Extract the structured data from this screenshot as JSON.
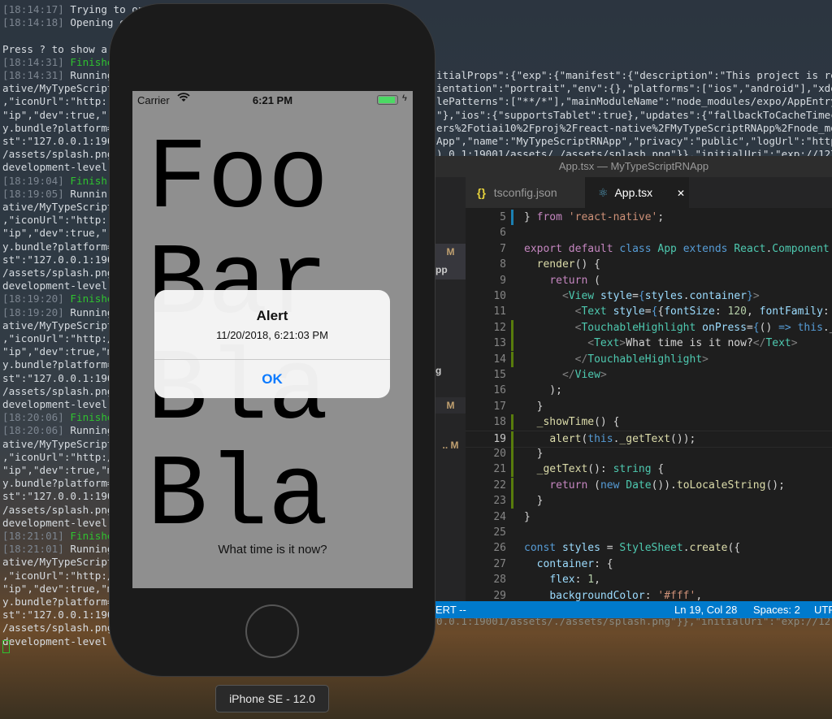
{
  "terminal": {
    "lines": [
      {
        "ts": "[18:14:17]",
        "g": "",
        "s": " Trying to open the project in iOS simulator"
      },
      {
        "ts": "[18:14:18]",
        "g": "",
        "s": " Opening e"
      },
      {
        "ts": "",
        "g": "",
        "s": ""
      },
      {
        "ts": "",
        "g": "",
        "s": "Press ? to show a"
      },
      {
        "ts": "[18:14:31]",
        "g": " Finishe",
        "s": ""
      },
      {
        "ts": "[18:14:31]",
        "g": "",
        "s": " Running"
      },
      {
        "ts": "",
        "g": "",
        "s": "ative/MyTypeScript"
      },
      {
        "ts": "",
        "g": "",
        "s": ",\"iconUrl\":\"http:"
      },
      {
        "ts": "",
        "g": "",
        "s": "\"ip\",\"dev\":true,\""
      },
      {
        "ts": "",
        "g": "",
        "s": "y.bundle?platform="
      },
      {
        "ts": "",
        "g": "",
        "s": "st\":\"127.0.0.1:190"
      },
      {
        "ts": "",
        "g": "",
        "s": "/assets/splash.png"
      },
      {
        "ts": "",
        "g": "",
        "s": "development-level"
      },
      {
        "ts": "[18:19:04]",
        "g": " Finish",
        "s": ""
      },
      {
        "ts": "[18:19:05]",
        "g": "",
        "s": " Runnin"
      },
      {
        "ts": "",
        "g": "",
        "s": "ative/MyTypeScript"
      },
      {
        "ts": "",
        "g": "",
        "s": ",\"iconUrl\":\"http:"
      },
      {
        "ts": "",
        "g": "",
        "s": "\"ip\",\"dev\":true,\""
      },
      {
        "ts": "",
        "g": "",
        "s": "y.bundle?platform="
      },
      {
        "ts": "",
        "g": "",
        "s": "st\":\"127.0.0.1:190"
      },
      {
        "ts": "",
        "g": "",
        "s": "/assets/splash.png"
      },
      {
        "ts": "",
        "g": "",
        "s": "development-level"
      },
      {
        "ts": "[18:19:20]",
        "g": " Finishe",
        "s": ""
      },
      {
        "ts": "[18:19:20]",
        "g": "",
        "s": " Running"
      },
      {
        "ts": "",
        "g": "",
        "s": "ative/MyTypeScript"
      },
      {
        "ts": "",
        "g": "",
        "s": ",\"iconUrl\":\"http:/"
      },
      {
        "ts": "",
        "g": "",
        "s": "\"ip\",\"dev\":true,\"m"
      },
      {
        "ts": "",
        "g": "",
        "s": "y.bundle?platform="
      },
      {
        "ts": "",
        "g": "",
        "s": "st\":\"127.0.0.1:190"
      },
      {
        "ts": "",
        "g": "",
        "s": "/assets/splash.png"
      },
      {
        "ts": "",
        "g": "",
        "s": "development-level"
      },
      {
        "ts": "[18:20:06]",
        "g": " Finishe",
        "s": ""
      },
      {
        "ts": "[18:20:06]",
        "g": "",
        "s": " Running"
      },
      {
        "ts": "",
        "g": "",
        "s": "ative/MyTypeScript"
      },
      {
        "ts": "",
        "g": "",
        "s": ",\"iconUrl\":\"http:/"
      },
      {
        "ts": "",
        "g": "",
        "s": "\"ip\",\"dev\":true,\"m"
      },
      {
        "ts": "",
        "g": "",
        "s": "y.bundle?platform="
      },
      {
        "ts": "",
        "g": "",
        "s": "st\":\"127.0.0.1:190"
      },
      {
        "ts": "",
        "g": "",
        "s": "/assets/splash.png"
      },
      {
        "ts": "",
        "g": "",
        "s": "development-level"
      },
      {
        "ts": "[18:21:01]",
        "g": " Finishe",
        "s": ""
      },
      {
        "ts": "[18:21:01]",
        "g": "",
        "s": " Running"
      },
      {
        "ts": "",
        "g": "",
        "s": "ative/MyTypeScript"
      },
      {
        "ts": "",
        "g": "",
        "s": ",\"iconUrl\":\"http:/"
      },
      {
        "ts": "",
        "g": "",
        "s": "\"ip\",\"dev\":true,\"m"
      },
      {
        "ts": "",
        "g": "",
        "s": "y.bundle?platform="
      },
      {
        "ts": "",
        "g": "",
        "s": "st\":\"127.0.0.1:190"
      },
      {
        "ts": "",
        "g": "",
        "s": "/assets/splash.png"
      },
      {
        "ts": "",
        "g": "",
        "s": "development-level"
      }
    ],
    "right_fragments": [
      "itialProps\":{\"exp\":{\"manifest\":{\"description\":\"This project is re",
      "ientation\":\"portrait\",\"env\":{},\"platforms\":[\"ios\",\"android\"],\"xde",
      "lePatterns\":[\"**/*\"],\"mainModuleName\":\"node_modules/expo/AppEntry",
      "\"},\"ios\":{\"supportsTablet\":true},\"updates\":{\"fallbackToCacheTimec",
      "ers%2Fotiai10%2Fproj%2Freact-native%2FMyTypeScriptRNApp%2Fnode_mo",
      "App\",\"name\":\"MyTypeScriptRNApp\",\"privacy\":\"public\",\"logUrl\":\"http",
      ").0.1:19001/assets/./assets/splash.png\"}},\"initialUri\":\"exp://127"
    ],
    "bottom_fragment": "0.0.1:19001/assets/./assets/splash.png\"}},\"initialUri\":\"exp://127"
  },
  "vscode": {
    "title": "App.tsx — MyTypeScriptRNApp",
    "sidebar_badges": [
      "M",
      "pp",
      "g",
      "M",
      ".. M"
    ],
    "tabs": [
      {
        "icon": "{}",
        "label": "tsconfig.json",
        "active": false
      },
      {
        "icon": "react-icon",
        "label": "App.tsx",
        "active": true,
        "close": "✕"
      }
    ],
    "current_line": 19,
    "lines": [
      {
        "n": 5,
        "tokens": [
          [
            "d",
            "} "
          ],
          [
            "k",
            "from"
          ],
          [
            "d",
            " "
          ],
          [
            "s",
            "'react-native'"
          ],
          [
            "d",
            ";"
          ]
        ]
      },
      {
        "n": 6,
        "tokens": []
      },
      {
        "n": 7,
        "tokens": [
          [
            "k",
            "export"
          ],
          [
            "d",
            " "
          ],
          [
            "k",
            "default"
          ],
          [
            "d",
            " "
          ],
          [
            "b",
            "class"
          ],
          [
            "d",
            " "
          ],
          [
            "t",
            "App"
          ],
          [
            "d",
            " "
          ],
          [
            "b",
            "extends"
          ],
          [
            "d",
            " "
          ],
          [
            "t",
            "React"
          ],
          [
            "d",
            "."
          ],
          [
            "t",
            "Component"
          ]
        ]
      },
      {
        "n": 8,
        "tokens": [
          [
            "d",
            "  "
          ],
          [
            "f",
            "render"
          ],
          [
            "d",
            "() {"
          ]
        ]
      },
      {
        "n": 9,
        "tokens": [
          [
            "d",
            "    "
          ],
          [
            "k",
            "return"
          ],
          [
            "d",
            " ("
          ]
        ]
      },
      {
        "n": 10,
        "tokens": [
          [
            "d",
            "      "
          ],
          [
            "g",
            "<"
          ],
          [
            "t",
            "View"
          ],
          [
            "d",
            " "
          ],
          [
            "v",
            "style"
          ],
          [
            "d",
            "="
          ],
          [
            "b",
            "{"
          ],
          [
            "v",
            "styles"
          ],
          [
            "d",
            "."
          ],
          [
            "v",
            "container"
          ],
          [
            "b",
            "}"
          ],
          [
            "g",
            ">"
          ]
        ]
      },
      {
        "n": 11,
        "tokens": [
          [
            "d",
            "        "
          ],
          [
            "g",
            "<"
          ],
          [
            "t",
            "Text"
          ],
          [
            "d",
            " "
          ],
          [
            "v",
            "style"
          ],
          [
            "d",
            "="
          ],
          [
            "b",
            "{"
          ],
          [
            "d",
            "{"
          ],
          [
            "v",
            "fontSize"
          ],
          [
            "d",
            ": "
          ],
          [
            "n",
            "120"
          ],
          [
            "d",
            ", "
          ],
          [
            "v",
            "fontFamily"
          ],
          [
            "d",
            ":"
          ]
        ]
      },
      {
        "n": 12,
        "tokens": [
          [
            "d",
            "        "
          ],
          [
            "g",
            "<"
          ],
          [
            "t",
            "TouchableHighlight"
          ],
          [
            "d",
            " "
          ],
          [
            "v",
            "onPress"
          ],
          [
            "d",
            "="
          ],
          [
            "b",
            "{"
          ],
          [
            "d",
            "() "
          ],
          [
            "b",
            "=>"
          ],
          [
            "d",
            " "
          ],
          [
            "b",
            "this"
          ],
          [
            "d",
            "._"
          ]
        ]
      },
      {
        "n": 13,
        "tokens": [
          [
            "d",
            "          "
          ],
          [
            "g",
            "<"
          ],
          [
            "t",
            "Text"
          ],
          [
            "g",
            ">"
          ],
          [
            "d",
            "What time is it now?"
          ],
          [
            "g",
            "</"
          ],
          [
            "t",
            "Text"
          ],
          [
            "g",
            ">"
          ]
        ]
      },
      {
        "n": 14,
        "tokens": [
          [
            "d",
            "        "
          ],
          [
            "g",
            "</"
          ],
          [
            "t",
            "TouchableHighlight"
          ],
          [
            "g",
            ">"
          ]
        ]
      },
      {
        "n": 15,
        "tokens": [
          [
            "d",
            "      "
          ],
          [
            "g",
            "</"
          ],
          [
            "t",
            "View"
          ],
          [
            "g",
            ">"
          ]
        ]
      },
      {
        "n": 16,
        "tokens": [
          [
            "d",
            "    );"
          ]
        ]
      },
      {
        "n": 17,
        "tokens": [
          [
            "d",
            "  }"
          ]
        ]
      },
      {
        "n": 18,
        "tokens": [
          [
            "d",
            "  "
          ],
          [
            "f",
            "_showTime"
          ],
          [
            "d",
            "() {"
          ]
        ]
      },
      {
        "n": 19,
        "tokens": [
          [
            "d",
            "    "
          ],
          [
            "f",
            "alert"
          ],
          [
            "d",
            "("
          ],
          [
            "b",
            "this"
          ],
          [
            "d",
            "."
          ],
          [
            "f",
            "_getText"
          ],
          [
            "d",
            "());"
          ]
        ]
      },
      {
        "n": 20,
        "tokens": [
          [
            "d",
            "  }"
          ]
        ]
      },
      {
        "n": 21,
        "tokens": [
          [
            "d",
            "  "
          ],
          [
            "f",
            "_getText"
          ],
          [
            "d",
            "(): "
          ],
          [
            "t",
            "string"
          ],
          [
            "d",
            " {"
          ]
        ]
      },
      {
        "n": 22,
        "tokens": [
          [
            "d",
            "    "
          ],
          [
            "k",
            "return"
          ],
          [
            "d",
            " ("
          ],
          [
            "b",
            "new"
          ],
          [
            "d",
            " "
          ],
          [
            "t",
            "Date"
          ],
          [
            "d",
            "())."
          ],
          [
            "f",
            "toLocaleString"
          ],
          [
            "d",
            "();"
          ]
        ]
      },
      {
        "n": 23,
        "tokens": [
          [
            "d",
            "  }"
          ]
        ]
      },
      {
        "n": 24,
        "tokens": [
          [
            "d",
            "}"
          ]
        ]
      },
      {
        "n": 25,
        "tokens": []
      },
      {
        "n": 26,
        "tokens": [
          [
            "b",
            "const"
          ],
          [
            "d",
            " "
          ],
          [
            "v",
            "styles"
          ],
          [
            "d",
            " = "
          ],
          [
            "t",
            "StyleSheet"
          ],
          [
            "d",
            "."
          ],
          [
            "f",
            "create"
          ],
          [
            "d",
            "({"
          ]
        ]
      },
      {
        "n": 27,
        "tokens": [
          [
            "d",
            "  "
          ],
          [
            "v",
            "container"
          ],
          [
            "d",
            ": {"
          ]
        ]
      },
      {
        "n": 28,
        "tokens": [
          [
            "d",
            "    "
          ],
          [
            "v",
            "flex"
          ],
          [
            "d",
            ": "
          ],
          [
            "n",
            "1"
          ],
          [
            "d",
            ","
          ]
        ]
      },
      {
        "n": 29,
        "tokens": [
          [
            "d",
            "    "
          ],
          [
            "v",
            "backgroundColor"
          ],
          [
            "d",
            ": "
          ],
          [
            "s",
            "'#fff'"
          ],
          [
            "d",
            ","
          ]
        ]
      }
    ],
    "status": {
      "mode": "ERT --",
      "position": "Ln 19, Col 28",
      "spaces": "Spaces: 2",
      "encoding": "UTF"
    },
    "accent": "#007acc"
  },
  "simulator": {
    "carrier": "Carrier",
    "time": "6:21 PM",
    "battery_level": 1.0,
    "battery_charging": true,
    "words": [
      "Foo",
      "Bar",
      "Bla",
      "Bla"
    ],
    "button_text": "What time is it now?",
    "alert": {
      "title": "Alert",
      "message": "11/20/2018, 6:21:03 PM",
      "ok": "OK"
    },
    "device_label": "iPhone SE - 12.0"
  }
}
